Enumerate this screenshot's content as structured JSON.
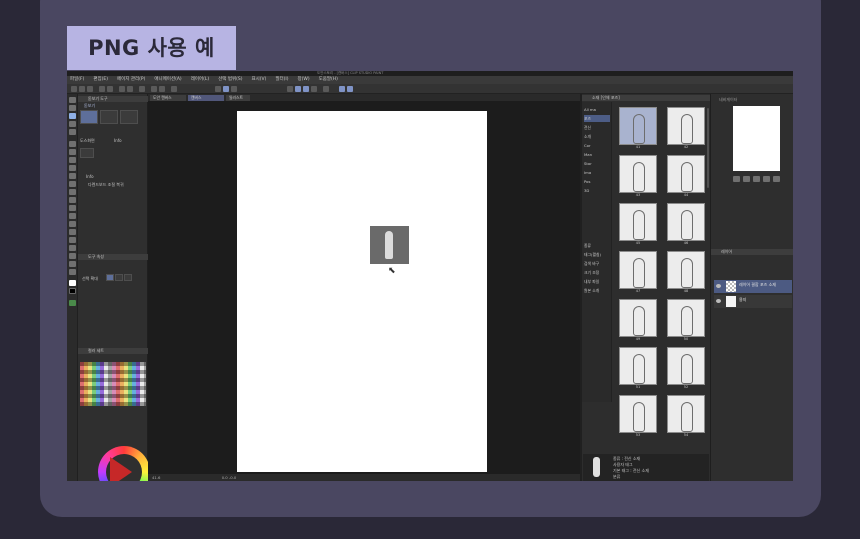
{
  "caption": "PNG 사용 예",
  "app": {
    "window_title": "도안스토리 - [캔버스] CLIP STUDIO PAINT",
    "menu": [
      "파일(F)",
      "편집(E)",
      "페이지 관리(P)",
      "애니메이션(A)",
      "레이어(L)",
      "선택 범위(S)",
      "표시(V)",
      "필터(I)",
      "창(W)",
      "도움말(H)"
    ],
    "tabs": [
      "도안 캔버스",
      "캔버스",
      "일러스트"
    ],
    "subtool_header": "돋보기 도구",
    "subtool_items": [
      "돋보기",
      "스크롤",
      "회전"
    ],
    "subtool_text": [
      "도스화면",
      "Info",
      "다렌드보드 조절 복귀"
    ],
    "tool_prop_header": "도구 속성",
    "tool_prop_label": "선택 확대",
    "color_set_header": "컬러 세트",
    "status_zoom": "41.6",
    "status_coords": "0.0  -0.0",
    "material_header": "소재 [인체 포즈]",
    "material_tree": [
      "All ma",
      "포즈",
      "전신",
      "소개",
      "Cor",
      "Man",
      "Stor",
      "Ima",
      "Pos",
      "3D"
    ],
    "material_props": [
      "종류",
      "태그(펼침)",
      "검색 바구",
      "크기 조정",
      "내부 파일",
      "원본 소개"
    ],
    "material_numbers": [
      "41",
      "42",
      "43",
      "44",
      "45",
      "46",
      "47",
      "48",
      "49",
      "50",
      "51",
      "52",
      "53",
      "54"
    ],
    "material_info": [
      "종류 : 전신 소재",
      "사용자 태그",
      "기본 태그 : 전신 소재",
      "분류"
    ],
    "layer_header": "레이어",
    "layers": [
      "레이어 결합 포즈 소재",
      "용지"
    ],
    "nav_label": "네비게이터"
  }
}
